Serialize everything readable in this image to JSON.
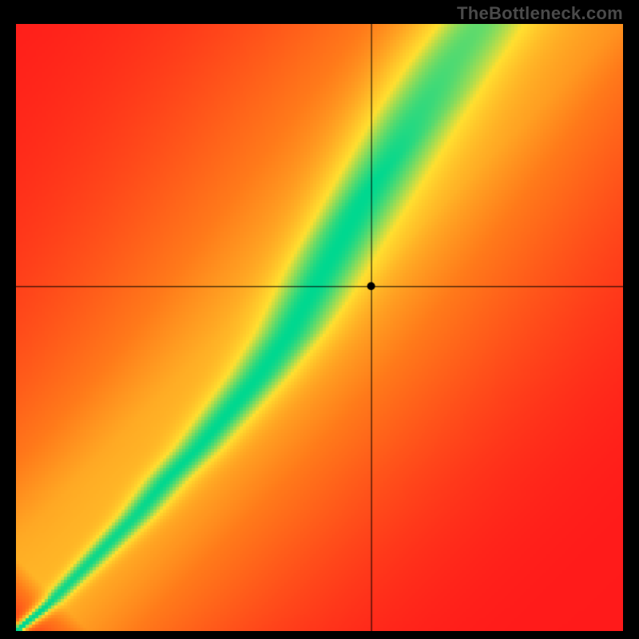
{
  "watermark": "TheBottleneck.com",
  "chart_data": {
    "type": "heatmap",
    "title": "",
    "xlabel": "",
    "ylabel": "",
    "xlim": [
      0,
      1
    ],
    "ylim": [
      0,
      1
    ],
    "crosshair": {
      "x": 0.585,
      "y": 0.568
    },
    "ridge_curve": [
      {
        "x": 0.0,
        "y": 0.0
      },
      {
        "x": 0.05,
        "y": 0.04
      },
      {
        "x": 0.1,
        "y": 0.09
      },
      {
        "x": 0.15,
        "y": 0.14
      },
      {
        "x": 0.2,
        "y": 0.19
      },
      {
        "x": 0.25,
        "y": 0.25
      },
      {
        "x": 0.3,
        "y": 0.3
      },
      {
        "x": 0.35,
        "y": 0.36
      },
      {
        "x": 0.4,
        "y": 0.42
      },
      {
        "x": 0.45,
        "y": 0.49
      },
      {
        "x": 0.5,
        "y": 0.58
      },
      {
        "x": 0.55,
        "y": 0.67
      },
      {
        "x": 0.6,
        "y": 0.76
      },
      {
        "x": 0.65,
        "y": 0.85
      },
      {
        "x": 0.7,
        "y": 0.93
      },
      {
        "x": 0.75,
        "y": 1.0
      }
    ],
    "ridge_half_width": 0.045,
    "colors": {
      "red": "#ff1a1a",
      "orange": "#ff7a1a",
      "yellow": "#ffe030",
      "green": "#00d890"
    },
    "marker": {
      "x": 0.585,
      "y": 0.568,
      "radius": 5
    },
    "resolution": 190
  }
}
